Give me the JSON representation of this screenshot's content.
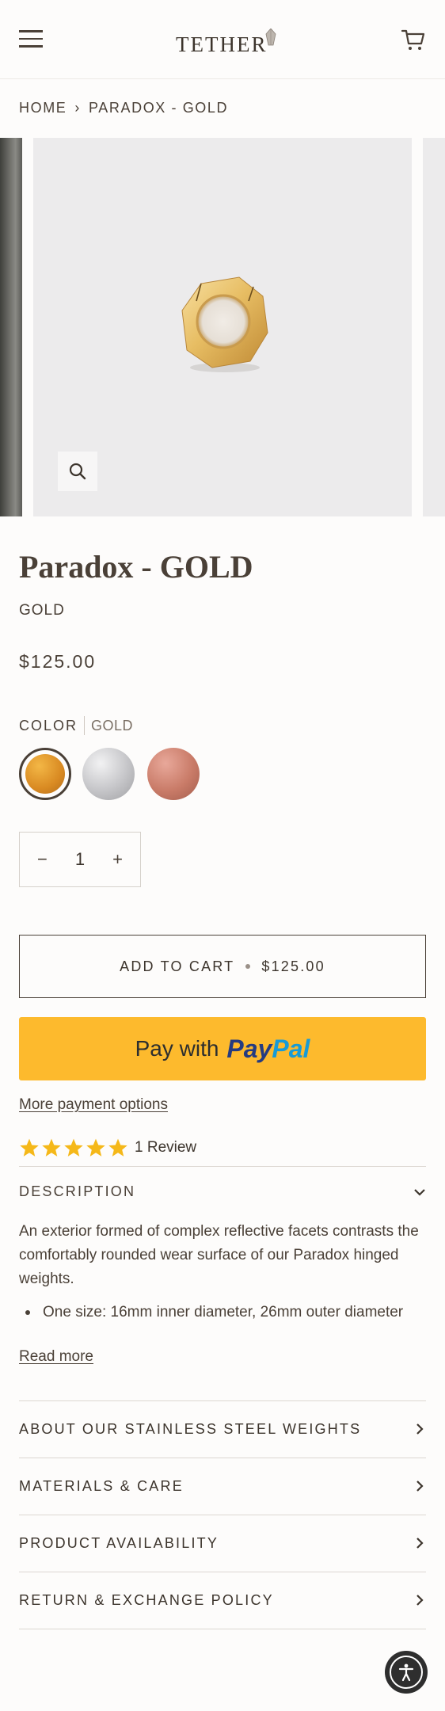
{
  "header": {
    "logo_text": "TETHER",
    "menu_icon": "hamburger-menu-icon",
    "cart_icon": "shopping-cart-icon"
  },
  "breadcrumb": {
    "home": "HOME",
    "separator": "›",
    "current": "PARADOX - GOLD"
  },
  "product": {
    "title": "Paradox - GOLD",
    "variant": "GOLD",
    "price": "$125.00",
    "color_label": "COLOR",
    "color_value": "GOLD",
    "swatches": [
      {
        "name": "Gold",
        "color": "#d98a22",
        "selected": true
      },
      {
        "name": "Silver",
        "color": "#c9c9cc",
        "selected": false
      },
      {
        "name": "Rose Gold",
        "color": "#c97b68",
        "selected": false
      }
    ],
    "quantity": {
      "minus": "−",
      "value": "1",
      "plus": "+"
    },
    "add_to_cart_label": "ADD TO CART",
    "add_to_cart_price": "$125.00",
    "paypal_prefix": "Pay with",
    "paypal_brand_1": "Pay",
    "paypal_brand_2": "Pal",
    "more_payment_options": "More payment options",
    "rating": 5,
    "reviews_text": "1 Review"
  },
  "description": {
    "heading": "DESCRIPTION",
    "body": "An exterior formed of complex reflective facets contrasts the comfortably rounded wear surface of our Paradox hinged weights.",
    "bullets": [
      "One size: 16mm inner diameter, 26mm outer diameter"
    ],
    "read_more": "Read more"
  },
  "accordion": [
    {
      "label": "ABOUT OUR STAINLESS STEEL WEIGHTS"
    },
    {
      "label": "MATERIALS & CARE"
    },
    {
      "label": "PRODUCT AVAILABILITY"
    },
    {
      "label": "RETURN & EXCHANGE POLICY"
    }
  ],
  "colors": {
    "text": "#4a4037",
    "paypal_yellow": "#fdba2d",
    "star": "#f5b819"
  }
}
